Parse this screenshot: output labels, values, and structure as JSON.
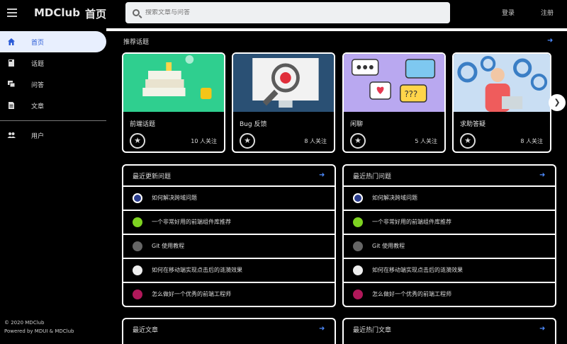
{
  "header": {
    "brand": "MDClub",
    "brand_sub": "首页",
    "search_placeholder": "搜索文章与问答",
    "link_left": "登录",
    "link_right": "注册"
  },
  "sidebar": {
    "items": [
      {
        "label": "首页",
        "icon": "home-icon",
        "active": true
      },
      {
        "label": "话题",
        "icon": "book-icon"
      },
      {
        "label": "问答",
        "icon": "forum-icon"
      },
      {
        "label": "文章",
        "icon": "article-icon"
      },
      {
        "label": "用户",
        "icon": "people-icon"
      }
    ],
    "footer_copyright": "© 2020 MDClub",
    "footer_powered": "Powered by MDUI & MDClub"
  },
  "topics": {
    "title": "推荐话题",
    "cards": [
      {
        "name": "前端话题",
        "followers": "10 人关注"
      },
      {
        "name": "Bug 反馈",
        "followers": "8 人关注"
      },
      {
        "name": "闲聊",
        "followers": "5 人关注"
      },
      {
        "name": "求助答疑",
        "followers": "8 人关注"
      }
    ]
  },
  "panel_latest_questions": {
    "title": "最近更新问题",
    "rows": [
      {
        "text": "如何解决跨域问题",
        "color": "#2c3e8f"
      },
      {
        "text": "一个非常好用的前端组件库推荐",
        "color": "#7ed321"
      },
      {
        "text": "Git 使用教程",
        "color": "#666666"
      },
      {
        "text": "如何在移动端实现点击后的涟漪效果",
        "color": "#eeeeee"
      },
      {
        "text": "怎么做好一个优秀的前端工程师",
        "color": "#b0185a"
      }
    ]
  },
  "panel_hot_questions": {
    "title": "最近热门问题",
    "rows": [
      {
        "text": "如何解决跨域问题",
        "color": "#2c3e8f"
      },
      {
        "text": "一个非常好用的前端组件库推荐",
        "color": "#7ed321"
      },
      {
        "text": "Git 使用教程",
        "color": "#666666"
      },
      {
        "text": "如何在移动端实现点击后的涟漪效果",
        "color": "#eeeeee"
      },
      {
        "text": "怎么做好一个优秀的前端工程师",
        "color": "#b0185a"
      }
    ]
  },
  "panel_latest_articles": {
    "title": "最近文章"
  },
  "panel_hot_articles": {
    "title": "最近热门文章"
  },
  "colors": {
    "accent": "#4e8cff",
    "active_bg": "#e8effe"
  }
}
